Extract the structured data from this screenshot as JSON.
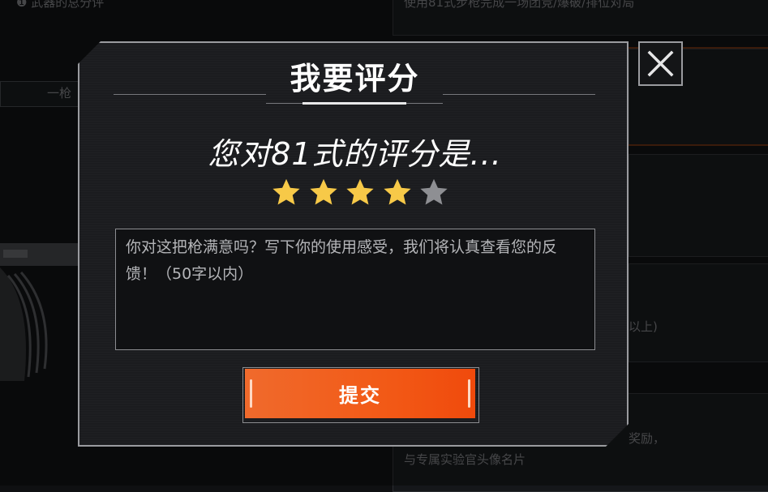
{
  "background": {
    "top_left_text": "❶ 武器的总分评",
    "top_right_text": "使用81式步枪完成一场团竞/爆破/排位对局",
    "left_tab_text": "一枪",
    "right_mid_text": "以上)",
    "right_bottom_text_1": "奖励，",
    "right_bottom_text_2": "与专属实验官头像名片"
  },
  "dialog": {
    "title": "我要评分",
    "question": "您对81式的评分是...",
    "rating": {
      "value": 4,
      "max": 5,
      "filled_color": "#f7c948",
      "empty_color": "#8e8f93"
    },
    "feedback": {
      "value": "",
      "placeholder": "你对这把枪满意吗？写下你的使用感受，我们将认真查看您的反馈！（50字以内）"
    },
    "submit_label": "提交",
    "accent_color": "#f25a17"
  },
  "close_icon": "close-icon"
}
